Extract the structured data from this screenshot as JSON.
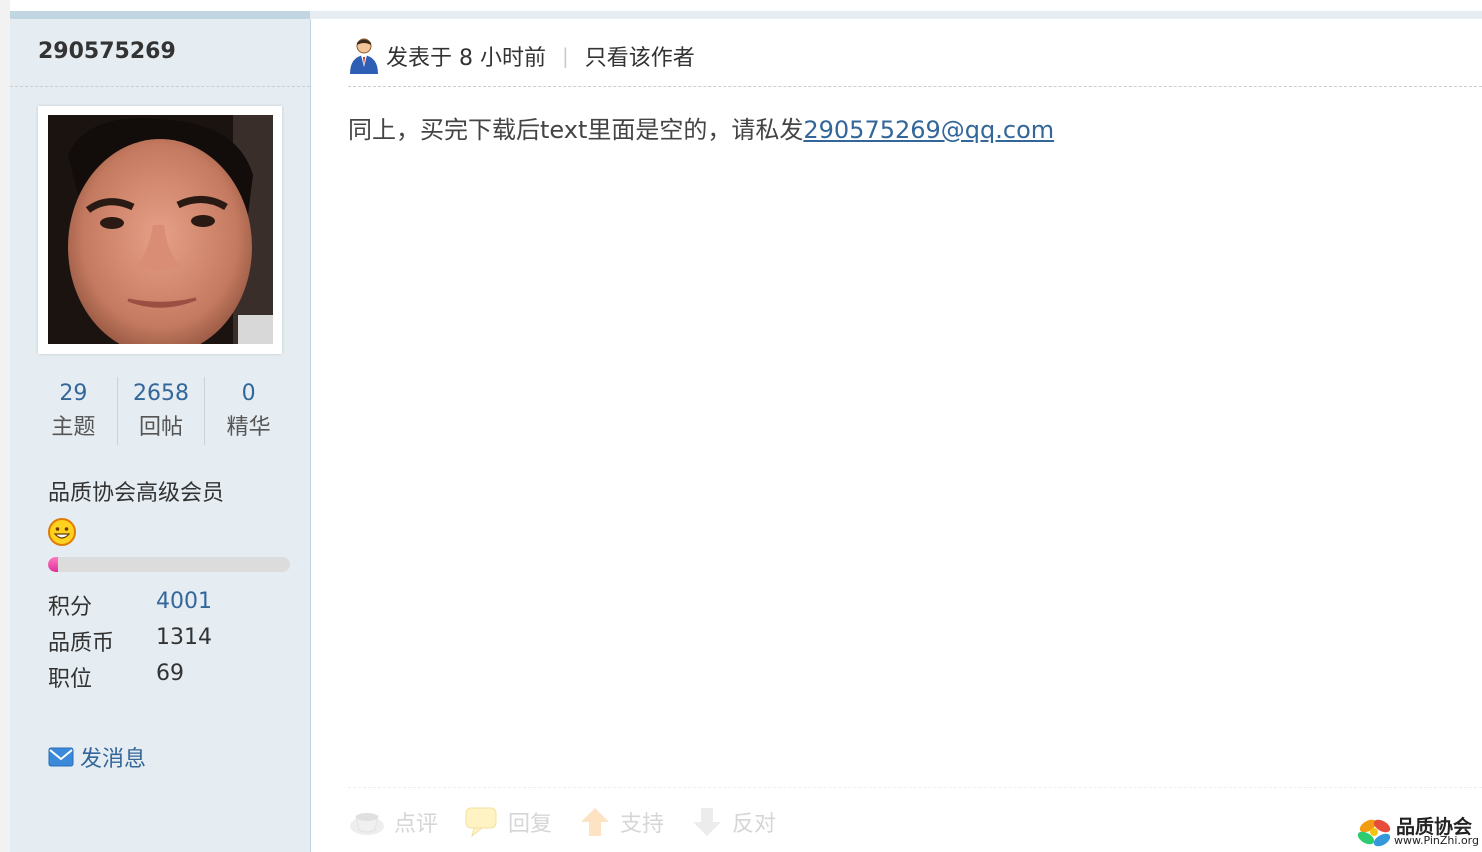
{
  "sidebar": {
    "username": "290575269",
    "stats": [
      {
        "value": "29",
        "label": "主题"
      },
      {
        "value": "2658",
        "label": "回帖"
      },
      {
        "value": "0",
        "label": "精华"
      }
    ],
    "rank_title": "品质协会高级会员",
    "level_progress_percent": 4,
    "info": [
      {
        "label": "积分",
        "value": "4001"
      },
      {
        "label": "品质币",
        "value": "1314"
      },
      {
        "label": "职位",
        "value": "69"
      }
    ],
    "send_message_label": "发消息"
  },
  "post": {
    "posted_time": "发表于 8 小时前",
    "separator": "|",
    "only_author_label": "只看该作者",
    "body_text": "同上，买完下载后text里面是空的，请私发",
    "body_link": "290575269@qq.com"
  },
  "actions": {
    "comment": "点评",
    "reply": "回复",
    "support": "支持",
    "oppose": "反对"
  },
  "logo": {
    "title": "品质协会",
    "url_text": "www.PinZhi.org"
  },
  "colors": {
    "sidebar_bg": "#e5edf2",
    "link": "#336699",
    "progress_fill": "#e0309a"
  }
}
